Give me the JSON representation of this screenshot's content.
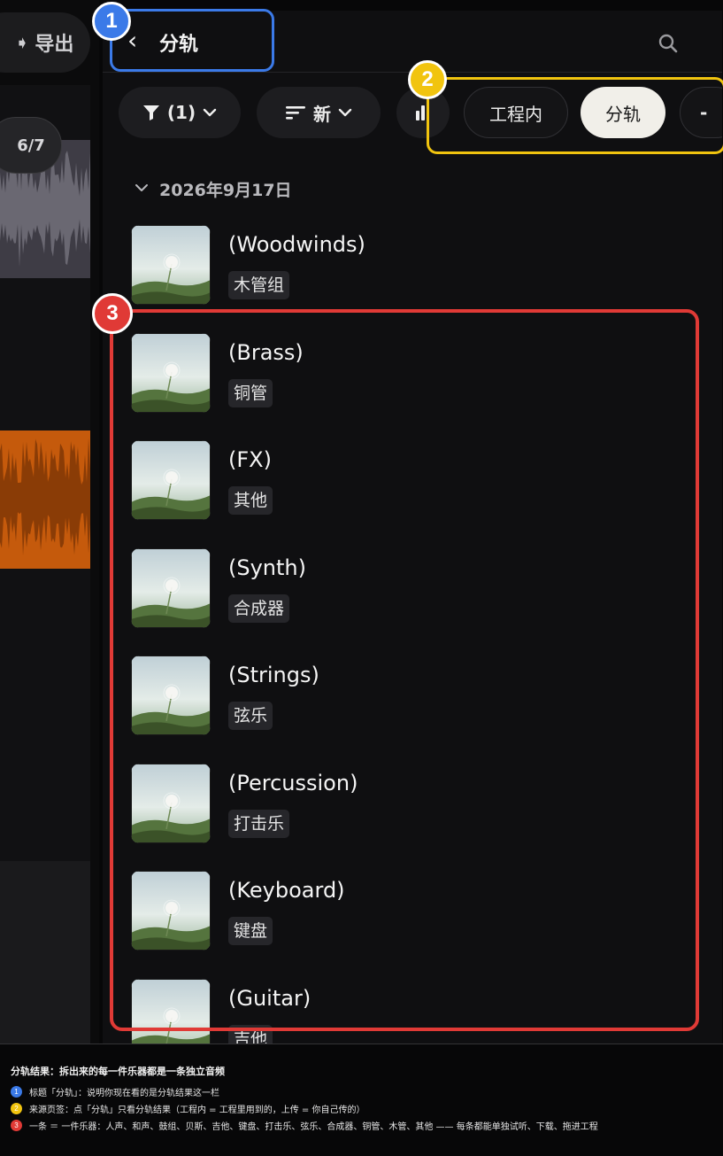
{
  "left_panel": {
    "export_label": "导出",
    "page_counter": "6/7"
  },
  "header": {
    "title": "分轨",
    "back_icon": "chevron-left-icon",
    "search_icon": "search-icon"
  },
  "filters": {
    "filter_count": "(1)",
    "sort_label": "新",
    "tabs": [
      {
        "label": "工程内",
        "active": false
      },
      {
        "label": "分轨",
        "active": true
      }
    ],
    "more_label": "-"
  },
  "list": {
    "date": "2026年9月17日",
    "items": [
      {
        "name": "(Woodwinds)",
        "tag": "木管组"
      },
      {
        "name": "(Brass)",
        "tag": "铜管"
      },
      {
        "name": "(FX)",
        "tag": "其他"
      },
      {
        "name": "(Synth)",
        "tag": "合成器"
      },
      {
        "name": "(Strings)",
        "tag": "弦乐"
      },
      {
        "name": "(Percussion)",
        "tag": "打击乐"
      },
      {
        "name": "(Keyboard)",
        "tag": "键盘"
      },
      {
        "name": "(Guitar)",
        "tag": "吉他"
      }
    ]
  },
  "callouts": [
    "1",
    "2",
    "3"
  ],
  "legend": {
    "title": "分轨结果：拆出来的每一件乐器都是一条独立音频",
    "rows": [
      {
        "num": "1",
        "color": "#3b7ae8",
        "text": "标题「分轨」：说明你现在看的是分轨结果这一栏"
      },
      {
        "num": "2",
        "color": "#f1c40f",
        "text": "来源页签：点「分轨」只看分轨结果（工程内 = 工程里用到的，上传 = 你自己传的）"
      },
      {
        "num": "3",
        "color": "#e03a36",
        "text": "一条 ＝ 一件乐器：人声、和声、鼓组、贝斯、吉他、键盘、打击乐、弦乐、合成器、铜管、木管、其他 —— 每条都能单独试听、下载、拖进工程"
      }
    ]
  },
  "colors": {
    "callout_blue": "#3b7ae8",
    "callout_yellow": "#f1c40f",
    "callout_red": "#e03a36",
    "active_tab_bg": "#f1efe9",
    "waveform_orange": "#c55a0c"
  }
}
